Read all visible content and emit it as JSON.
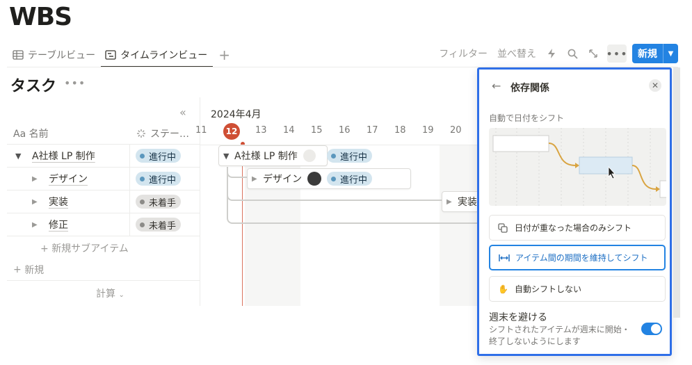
{
  "page": {
    "title": "WBS"
  },
  "tabs": [
    {
      "label": "テーブルビュー",
      "icon": "table-icon"
    },
    {
      "label": "タイムラインビュー",
      "icon": "timeline-icon"
    }
  ],
  "toolbar": {
    "filter": "フィルター",
    "sort": "並べ替え",
    "new_label": "新規"
  },
  "database": {
    "title": "タスク"
  },
  "table": {
    "col_name": "名前",
    "col_name_prefix": "Aa",
    "col_status": "ステー…",
    "rows": [
      {
        "name": "A社様 LP 制作",
        "status": "進行中"
      },
      {
        "name": "デザイン",
        "status": "進行中"
      },
      {
        "name": "実装",
        "status": "未着手"
      },
      {
        "name": "修正",
        "status": "未着手"
      }
    ],
    "add_sub": "新規サブアイテム",
    "add_new": "新規",
    "calc": "計算"
  },
  "timeline": {
    "month": "2024年4月",
    "days": [
      "11",
      "12",
      "13",
      "14",
      "15",
      "16",
      "17",
      "18",
      "19",
      "20"
    ],
    "today": "12",
    "bars": [
      {
        "name": "A社様 LP 制作",
        "status": "進行中"
      },
      {
        "name": "デザイン",
        "status": "進行中"
      },
      {
        "name": "実装"
      }
    ]
  },
  "panel": {
    "title": "依存関係",
    "section": "自動で日付をシフト",
    "options": [
      {
        "label": "日付が重なった場合のみシフト",
        "icon": "overlap-icon",
        "selected": false
      },
      {
        "label": "アイテム間の期間を維持してシフト",
        "icon": "keep-gap-icon",
        "selected": true
      },
      {
        "label": "自動シフトしない",
        "icon": "hand-icon",
        "selected": false
      }
    ],
    "weekend_title": "週末を避ける",
    "weekend_desc": "シフトされたアイテムが週末に開始・終了しないようにします",
    "weekend_enabled": true
  },
  "colors": {
    "accent": "#2383e2",
    "today": "#cf4f35",
    "panel_border": "#2f6fe8",
    "in_progress": "#d3e5ef",
    "not_started": "#e3e2e0"
  }
}
